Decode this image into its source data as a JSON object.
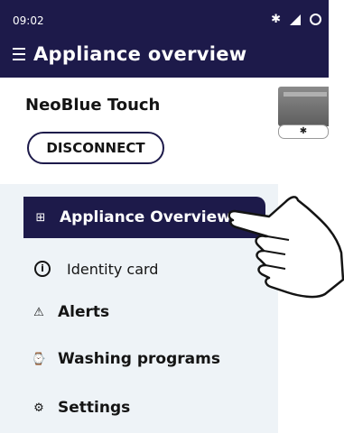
{
  "status_bar": {
    "time": "09:02",
    "bluetooth": "bluetooth-icon",
    "signal": "signal-icon"
  },
  "app_bar": {
    "title": "Appliance overview",
    "menu_icon": "hamburger-icon"
  },
  "drawer": {
    "device_name": "NeoBlue Touch",
    "disconnect_label": "DISCONNECT",
    "items": [
      {
        "label": "Appliance Overview",
        "icon": "grid-icon",
        "active": true
      },
      {
        "label": "Identity card",
        "icon": "info-icon",
        "active": false
      },
      {
        "label": "Alerts",
        "icon": "warning-icon",
        "active": false
      },
      {
        "label": "Washing programs",
        "icon": "dishwasher-icon",
        "active": false
      },
      {
        "label": "Settings",
        "icon": "gear-icon",
        "active": false
      }
    ]
  },
  "appliance": {
    "badge": "✱"
  },
  "colors": {
    "primary": "#1d1a4a",
    "menu_bg": "#eef3f7"
  }
}
